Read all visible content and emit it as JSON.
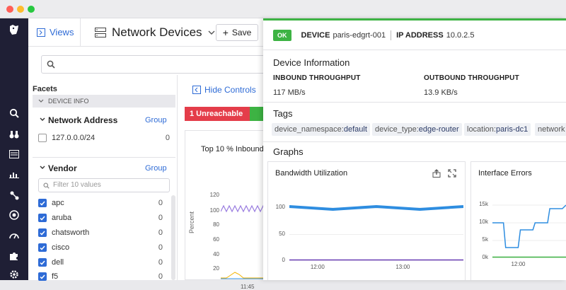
{
  "window": {
    "controls": [
      "close",
      "minimize",
      "maximize"
    ]
  },
  "colors": {
    "accent": "#2e6bd6",
    "ok": "#3db343",
    "danger": "#e43d4a",
    "sidebar": "#1f1f35"
  },
  "sidebar": {
    "icons": [
      "datadog-logo-icon",
      "search-icon",
      "binoculars-icon",
      "dashboard-icon",
      "chart-icon",
      "network-icon",
      "target-icon",
      "gauge-icon",
      "puzzle-icon",
      "settings-icon"
    ]
  },
  "header": {
    "views_label": "Views",
    "page_title": "Network Devices",
    "save_label": "Save"
  },
  "search": {
    "placeholder": ""
  },
  "facets": {
    "title": "Facets",
    "device_info_label": "DEVICE INFO",
    "network_address": {
      "title": "Network Address",
      "group_label": "Group",
      "items": [
        {
          "label": "127.0.0.0/24",
          "count": "0",
          "checked": false
        }
      ]
    },
    "vendor": {
      "title": "Vendor",
      "group_label": "Group",
      "filter_placeholder": "Filter 10 values",
      "items": [
        {
          "label": "apc",
          "count": "0"
        },
        {
          "label": "aruba",
          "count": "0"
        },
        {
          "label": "chatsworth",
          "count": "0"
        },
        {
          "label": "cisco",
          "count": "0"
        },
        {
          "label": "dell",
          "count": "0"
        },
        {
          "label": "f5",
          "count": "0"
        }
      ]
    }
  },
  "controls": {
    "hide_controls_label": "Hide Controls"
  },
  "status": {
    "unreachable_label": "1 Unreachable"
  },
  "top_chart": {
    "title": "Top 10 % Inbound",
    "ylabel": "Percent",
    "y_ticks": [
      "120",
      "100",
      "80",
      "60",
      "40",
      "20",
      "0"
    ],
    "x_tick": "11:45"
  },
  "panel": {
    "status_badge": "OK",
    "device_label": "DEVICE",
    "device_value": "paris-edgrt-001",
    "ip_label": "IP ADDRESS",
    "ip_value": "10.0.2.5",
    "device_info_title": "Device Information",
    "inbound_label": "INBOUND THROUGHPUT",
    "inbound_value": "117 MB/s",
    "outbound_label": "OUTBOUND THROUGHPUT",
    "outbound_value": "13.9 KB/s",
    "tags_title": "Tags",
    "tags": [
      {
        "key": "device_namespace:",
        "value": "default"
      },
      {
        "key": "device_type:",
        "value": "edge-router"
      },
      {
        "key": "location:",
        "value": "paris-dc1"
      },
      {
        "key": "network",
        "value": ""
      }
    ],
    "graphs_title": "Graphs"
  },
  "chart_data": [
    {
      "type": "line",
      "title": "Bandwidth Utilization",
      "y_ticks": [
        "100",
        "50",
        "0"
      ],
      "x_ticks": [
        "12:00",
        "13:00"
      ],
      "ylim": [
        0,
        120
      ],
      "series": [
        {
          "color": "#2e8de0",
          "values": [
            100,
            100,
            100,
            100,
            100
          ]
        },
        {
          "color": "#6a3fb5",
          "values": [
            2,
            2,
            2,
            2,
            2
          ]
        }
      ]
    },
    {
      "type": "line",
      "title": "Interface Errors",
      "y_ticks": [
        "15k",
        "10k",
        "5k",
        "0k"
      ],
      "x_ticks": [
        "12:00"
      ],
      "ylim": [
        0,
        16000
      ],
      "series": [
        {
          "color": "#2e8de0",
          "values": [
            10000,
            10000,
            3000,
            3000,
            8000,
            8000,
            10000,
            10000,
            14000,
            14000,
            15000
          ]
        },
        {
          "color": "#3db343",
          "values": [
            300,
            300,
            300,
            300,
            300,
            300,
            300,
            300,
            300,
            300,
            300
          ]
        }
      ]
    }
  ]
}
